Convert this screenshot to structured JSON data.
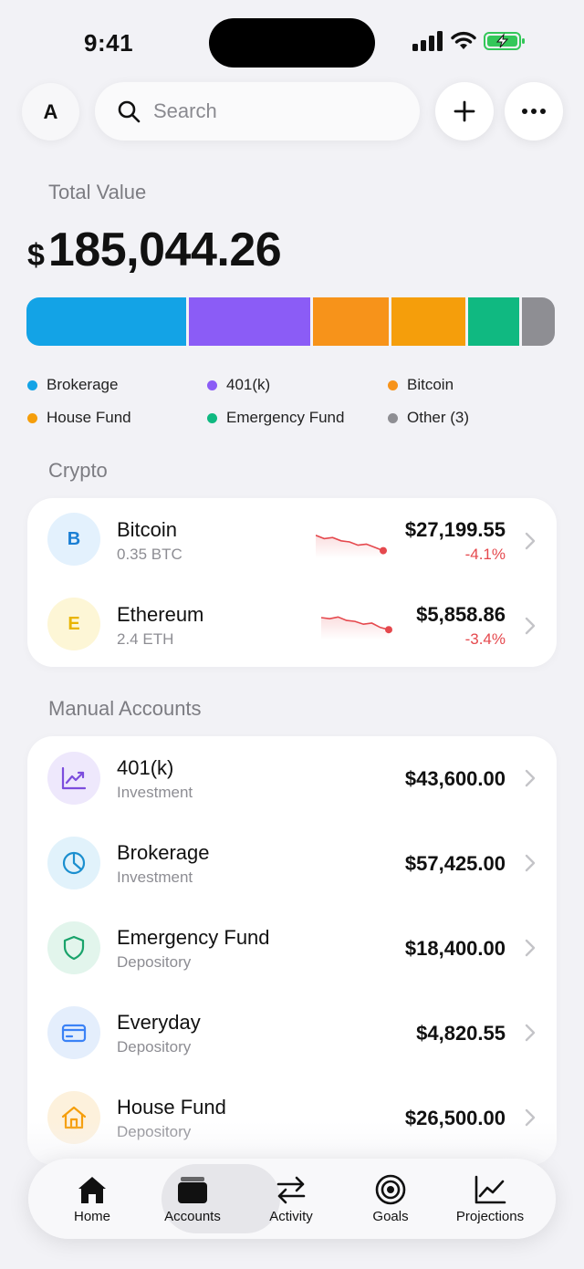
{
  "status_bar": {
    "time": "9:41"
  },
  "top_bar": {
    "avatar_initial": "A",
    "search_placeholder": "Search"
  },
  "total": {
    "label": "Total Value",
    "currency": "$",
    "amount": "185,044.26"
  },
  "allocation": [
    {
      "name": "Brokerage",
      "color": "#13a3e6",
      "share": 0.31
    },
    {
      "name": "401(k)",
      "color": "#8b5cf6",
      "share": 0.235
    },
    {
      "name": "Bitcoin",
      "color": "#f7931a",
      "share": 0.147
    },
    {
      "name": "House Fund",
      "color": "#f59e0b",
      "share": 0.143
    },
    {
      "name": "Emergency Fund",
      "color": "#10b981",
      "share": 0.099
    },
    {
      "name": "Other (3)",
      "color": "#8e8e93",
      "share": 0.066
    }
  ],
  "legend": [
    {
      "label": "Brokerage",
      "color": "#13a3e6"
    },
    {
      "label": "401(k)",
      "color": "#8b5cf6"
    },
    {
      "label": "Bitcoin",
      "color": "#f7931a"
    },
    {
      "label": "House Fund",
      "color": "#f59e0b"
    },
    {
      "label": "Emergency Fund",
      "color": "#10b981"
    },
    {
      "label": "Other (3)",
      "color": "#8e8e93"
    }
  ],
  "crypto": {
    "title": "Crypto",
    "items": [
      {
        "letter": "B",
        "name": "Bitcoin",
        "sub": "0.35 BTC",
        "amount": "$27,199.55",
        "change": "-4.1%",
        "icon_bg": "#e3f1fd",
        "icon_fg": "#1a7fd4",
        "trend": [
          0.2,
          0.35,
          0.3,
          0.45,
          0.5,
          0.65,
          0.6,
          0.75,
          0.9
        ]
      },
      {
        "letter": "E",
        "name": "Ethereum",
        "sub": "2.4 ETH",
        "amount": "$5,858.86",
        "change": "-3.4%",
        "icon_bg": "#fdf6d6",
        "icon_fg": "#e9b400",
        "trend": [
          0.25,
          0.3,
          0.22,
          0.38,
          0.42,
          0.55,
          0.5,
          0.7,
          0.8
        ]
      }
    ]
  },
  "manual": {
    "title": "Manual Accounts",
    "items": [
      {
        "icon": "chart-up-icon",
        "name": "401(k)",
        "sub": "Investment",
        "amount": "$43,600.00",
        "icon_bg": "#eee8fc",
        "icon_fg": "#7c4ddd"
      },
      {
        "icon": "pie-chart-icon",
        "name": "Brokerage",
        "sub": "Investment",
        "amount": "$57,425.00",
        "icon_bg": "#e1f2fb",
        "icon_fg": "#1b8fcf"
      },
      {
        "icon": "shield-icon",
        "name": "Emergency Fund",
        "sub": "Depository",
        "amount": "$18,400.00",
        "icon_bg": "#e2f5ec",
        "icon_fg": "#19a36b"
      },
      {
        "icon": "credit-card-icon",
        "name": "Everyday",
        "sub": "Depository",
        "amount": "$4,820.55",
        "icon_bg": "#e4eefc",
        "icon_fg": "#3b82f6"
      },
      {
        "icon": "house-icon",
        "name": "House Fund",
        "sub": "Depository",
        "amount": "$26,500.00",
        "icon_bg": "#fdf1dc",
        "icon_fg": "#f59e0b"
      }
    ]
  },
  "tabs": [
    {
      "label": "Home",
      "icon": "home-icon",
      "active": false
    },
    {
      "label": "Accounts",
      "icon": "wallet-icon",
      "active": true
    },
    {
      "label": "Activity",
      "icon": "transfer-arrows-icon",
      "active": false
    },
    {
      "label": "Goals",
      "icon": "target-icon",
      "active": false
    },
    {
      "label": "Projections",
      "icon": "trend-chart-icon",
      "active": false
    }
  ]
}
